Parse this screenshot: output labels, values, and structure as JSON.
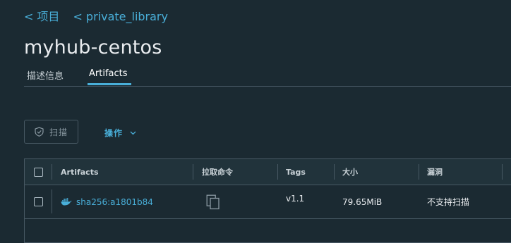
{
  "breadcrumbs": [
    {
      "label": "项目"
    },
    {
      "label": "private_library"
    }
  ],
  "page_title": "myhub-centos",
  "tabs": [
    {
      "label": "描述信息",
      "active": false
    },
    {
      "label": "Artifacts",
      "active": true
    }
  ],
  "toolbar": {
    "scan_label": "扫描",
    "actions_label": "操作"
  },
  "table": {
    "headers": [
      "Artifacts",
      "拉取命令",
      "Tags",
      "大小",
      "漏洞"
    ],
    "rows": [
      {
        "artifact": "sha256:a1801b84",
        "tags": "v1.1",
        "size": "79.65MiB",
        "vulnerabilities": "不支持扫描"
      }
    ]
  },
  "colors": {
    "background": "#1b2a32",
    "accent": "#49afd9",
    "border": "#485964"
  },
  "icons": [
    "chevron-left-icon",
    "shield-icon",
    "chevron-down-icon",
    "docker-icon",
    "copy-icon"
  ]
}
